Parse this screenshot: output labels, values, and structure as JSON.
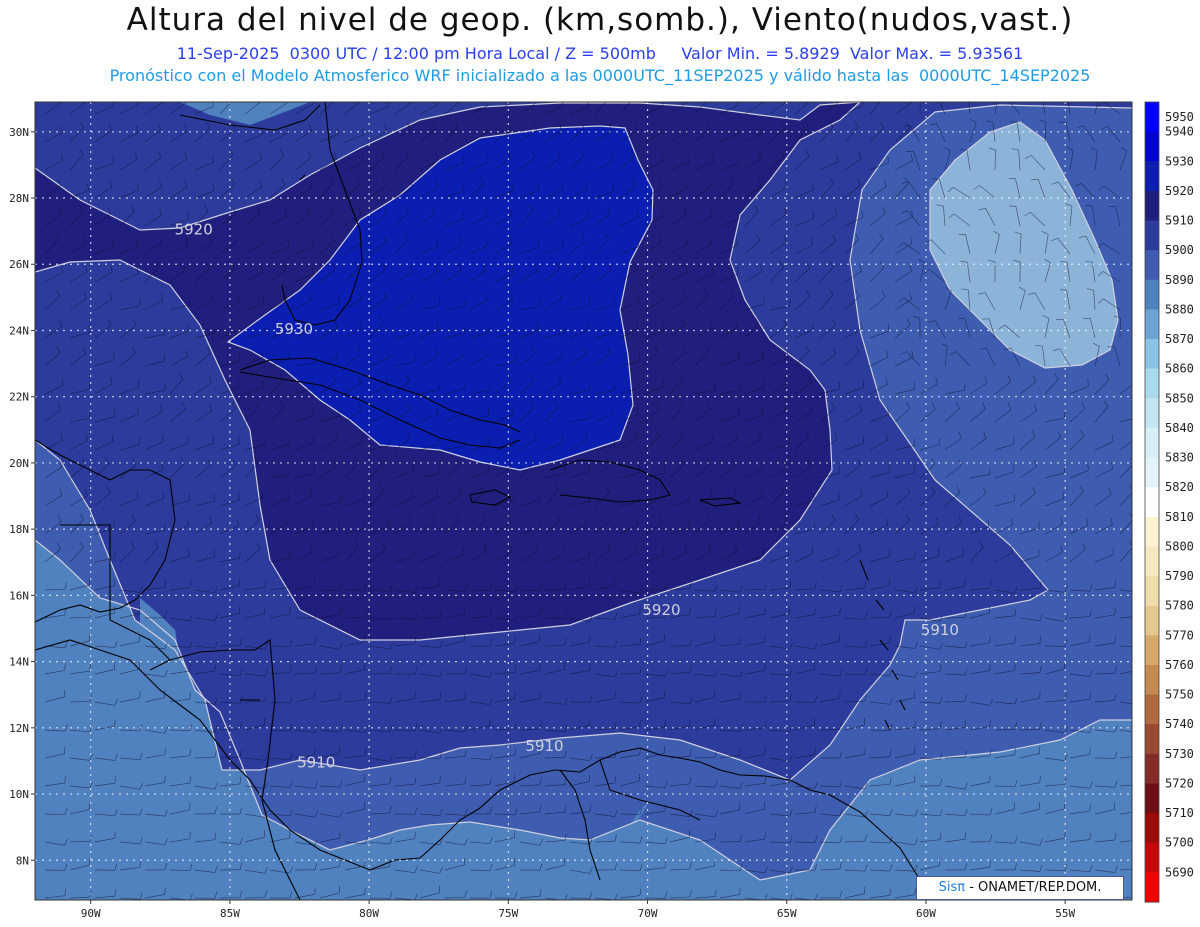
{
  "header": {
    "title": "Altura del nivel de geop. (km,somb.), Viento(nudos,vast.)",
    "line1": "11-Sep-2025  0300 UTC / 12:00 pm Hora Local / Z = 500mb     Valor Min. = 5.8929  Valor Max. = 5.93561",
    "line2": "Pronóstico con el Modelo Atmosferico WRF inicializado a las 0000UTC_11SEP2025 y válido hasta las  0000UTC_14SEP2025"
  },
  "map": {
    "lat_labels": [
      "30N",
      "28N",
      "26N",
      "24N",
      "22N",
      "20N",
      "18N",
      "16N",
      "14N",
      "12N",
      "10N",
      "8N"
    ],
    "lon_labels": [
      "90W",
      "85W",
      "80W",
      "75W",
      "70W",
      "65W",
      "60W",
      "55W"
    ],
    "contour_labels": [
      {
        "text": "5920",
        "lon": -86.3,
        "lat": 26.9
      },
      {
        "text": "5930",
        "lon": -82.7,
        "lat": 23.9
      },
      {
        "text": "5920",
        "lon": -69.5,
        "lat": 15.4
      },
      {
        "text": "5910",
        "lon": -59.5,
        "lat": 14.8
      },
      {
        "text": "5910",
        "lon": -73.7,
        "lat": 11.3
      },
      {
        "text": "5910",
        "lon": -81.9,
        "lat": 10.8
      }
    ],
    "colors": {
      "band_5880": "#8cb4d8",
      "band_5890": "#5182c0",
      "band_5900": "#3e5db0",
      "band_5910": "#2d3c9c",
      "band_5920": "#211f7e",
      "band_5930": "#0a1fb2",
      "contour_line": "#cfd0e0",
      "coast": "#000000"
    }
  },
  "colorbar": {
    "levels": [
      {
        "label": "5950",
        "color": "#0000ff"
      },
      {
        "label": "5940",
        "color": "#0000d0"
      },
      {
        "label": "5930",
        "color": "#0a1fb2"
      },
      {
        "label": "5920",
        "color": "#211f7e"
      },
      {
        "label": "5910",
        "color": "#2d3c9c"
      },
      {
        "label": "5900",
        "color": "#3e5db0"
      },
      {
        "label": "5890",
        "color": "#5182c0"
      },
      {
        "label": "5880",
        "color": "#6ea2d3"
      },
      {
        "label": "5870",
        "color": "#8dc4e3"
      },
      {
        "label": "5860",
        "color": "#aad8ec"
      },
      {
        "label": "5850",
        "color": "#c3e6f2"
      },
      {
        "label": "5840",
        "color": "#d7eef7"
      },
      {
        "label": "5830",
        "color": "#e5f4fa"
      },
      {
        "label": "5820",
        "color": "#ffffff"
      },
      {
        "label": "5810",
        "color": "#fbf3d4"
      },
      {
        "label": "5800",
        "color": "#f6e8bf"
      },
      {
        "label": "5790",
        "color": "#efdcaa"
      },
      {
        "label": "5780",
        "color": "#e5c890"
      },
      {
        "label": "5770",
        "color": "#d5a86c"
      },
      {
        "label": "5760",
        "color": "#c38a52"
      },
      {
        "label": "5750",
        "color": "#b06a40"
      },
      {
        "label": "5740",
        "color": "#9a4a34"
      },
      {
        "label": "5730",
        "color": "#832c28"
      },
      {
        "label": "5720",
        "color": "#6e0f14"
      },
      {
        "label": "5710",
        "color": "#9c0b0b"
      },
      {
        "label": "5700",
        "color": "#c80808"
      },
      {
        "label": "5690",
        "color": "#f00000"
      }
    ]
  },
  "credit": {
    "brand": "Sisπ",
    "text": " - ONAMET/REP.DOM."
  }
}
